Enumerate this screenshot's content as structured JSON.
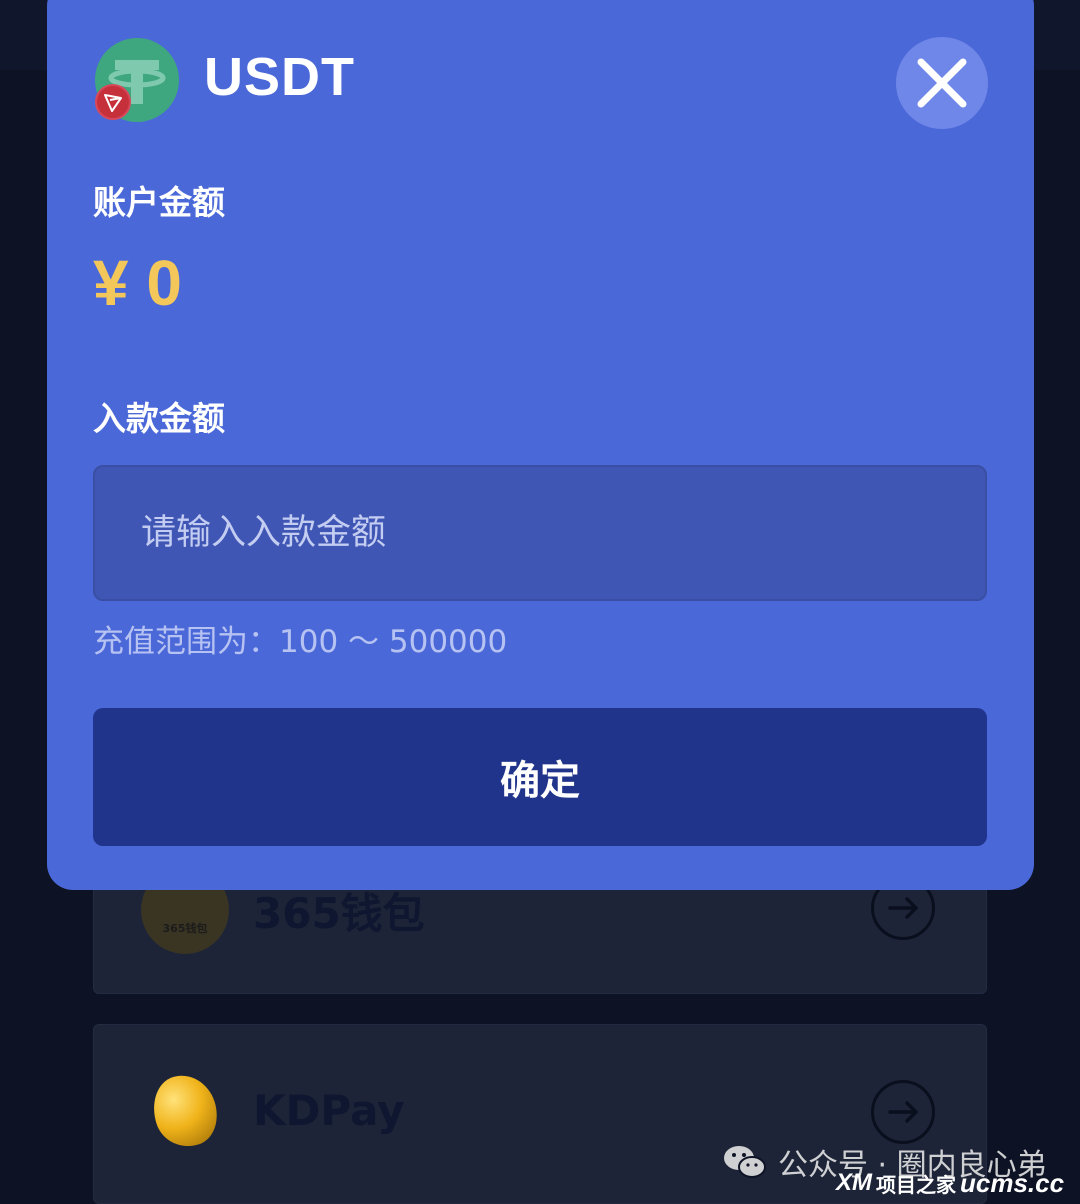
{
  "background": {
    "payment_methods": [
      {
        "name": "365钱包",
        "logo_text": "365钱包",
        "icon": "365-wallet-logo",
        "action_icon": "arrow-right-circle-icon"
      },
      {
        "name": "KDPay",
        "icon": "gold-bean-logo",
        "action_icon": "arrow-right-circle-icon"
      }
    ]
  },
  "modal": {
    "currency": "USDT",
    "coin_icon": "tether-icon",
    "network_badge_icon": "tron-icon",
    "close_icon": "close-icon",
    "balance_label": "账户金额",
    "balance_value": "¥ 0",
    "deposit_label": "入款金额",
    "amount_input": {
      "value": "",
      "placeholder": "请输入入款金额"
    },
    "range_hint": "充值范围为：100 ～ 500000",
    "confirm_label": "确定"
  },
  "watermark": {
    "wechat_text": "公众号 · 圈内良心弟",
    "site_logo": "XM",
    "site_name": "项目之家",
    "site_domain": "ucms.cc"
  },
  "colors": {
    "modal_bg": "#4b68d8",
    "input_bg": "#4056b5",
    "confirm_bg": "#1f348a",
    "balance_accent": "#f3c75a",
    "page_bg": "#0d1224"
  }
}
